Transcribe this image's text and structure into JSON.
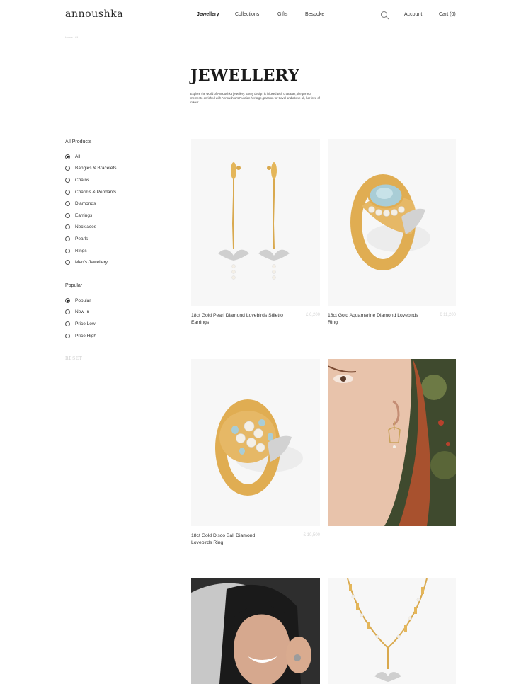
{
  "header": {
    "logo": "annoushka",
    "nav": [
      "Jewellery",
      "Collections",
      "Gifts",
      "Bespoke"
    ],
    "account": "Account",
    "cart": "Cart (0)"
  },
  "breadcrumb": "Home / All",
  "page": {
    "title": "JEWELLERY",
    "description": "Explore the world of Annoushka jewellery. Every design is infused with character, the perfect memento enriched with Annoushka's Russian heritage, passion for travel and above all, her love of colour."
  },
  "filters": {
    "category_title": "All Products",
    "categories": [
      "All",
      "Bangles & Bracelets",
      "Chains",
      "Charms & Pendants",
      "Diamonds",
      "Earrings",
      "Necklaces",
      "Pearls",
      "Rings",
      "Men's Jewellery"
    ],
    "sort_title": "Popular",
    "sort_options": [
      "Popular",
      "New In",
      "Price Low",
      "Price High"
    ],
    "reset": "RESET"
  },
  "products": [
    {
      "name": "18ct Gold Pearl Diamond Lovebirds Stiletto Earrings",
      "price": "£ 6,200"
    },
    {
      "name": "18ct Gold Aquamarine Diamond Lovebirds Ring",
      "price": "£ 11,200"
    },
    {
      "name": "18ct Gold Disco Ball Diamond Lovebirds Ring",
      "price": "£ 10,500"
    }
  ],
  "colors": {
    "gold": "#d9a94e",
    "aquamarine": "#a9cdd6",
    "pearl": "#f4efe6"
  }
}
